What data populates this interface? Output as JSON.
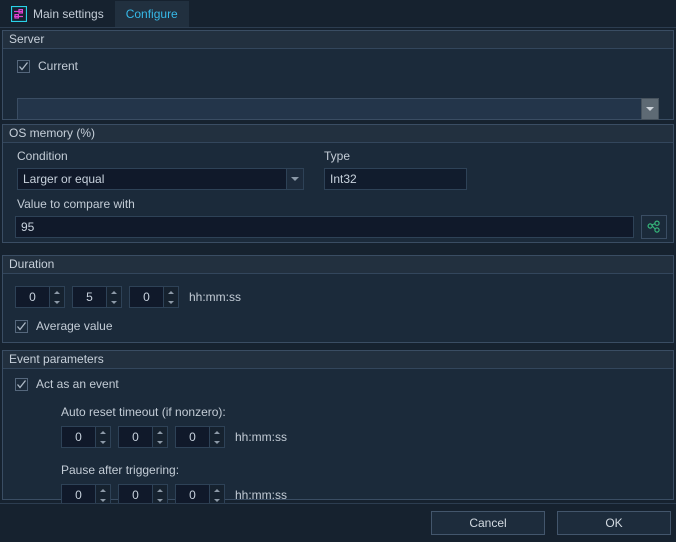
{
  "window": {
    "tabs": [
      {
        "label": "Main settings",
        "icon": "sliders-icon",
        "active": false
      },
      {
        "label": "Configure",
        "icon": "",
        "active": true
      }
    ]
  },
  "server": {
    "title": "Server",
    "current_checkbox": {
      "label": "Current",
      "checked": true
    },
    "server_select": {
      "value": "",
      "placeholder": ""
    }
  },
  "os_memory": {
    "title": "OS memory (%)",
    "condition_label": "Condition",
    "condition_value": "Larger or equal",
    "type_label": "Type",
    "type_value": "Int32",
    "value_label": "Value to compare with",
    "value_value": "95",
    "link_button_icon": "share-nodes-icon"
  },
  "duration": {
    "title": "Duration",
    "hours": "0",
    "minutes": "5",
    "seconds": "0",
    "format": "hh:mm:ss",
    "average_checkbox": {
      "label": "Average value",
      "checked": true
    }
  },
  "event_parameters": {
    "title": "Event parameters",
    "act_as_event": {
      "label": "Act as an event",
      "checked": true
    },
    "auto_reset_label": "Auto reset timeout (if nonzero):",
    "auto_reset": {
      "hours": "0",
      "minutes": "0",
      "seconds": "0",
      "format": "hh:mm:ss"
    },
    "pause_label": "Pause after triggering:",
    "pause": {
      "hours": "0",
      "minutes": "0",
      "seconds": "0",
      "format": "hh:mm:ss"
    }
  },
  "footer": {
    "cancel_label": "Cancel",
    "ok_label": "OK"
  },
  "colors": {
    "background": "#16222f",
    "group_bg": "#1b2a3a",
    "group_header": "#22303f",
    "border": "#3a4d63",
    "field_bg": "#10192a",
    "text": "#c3ccd6",
    "accent_cyan": "#36b9e8",
    "accent_magenta": "#e040d0",
    "accent_green": "#35b57a"
  }
}
